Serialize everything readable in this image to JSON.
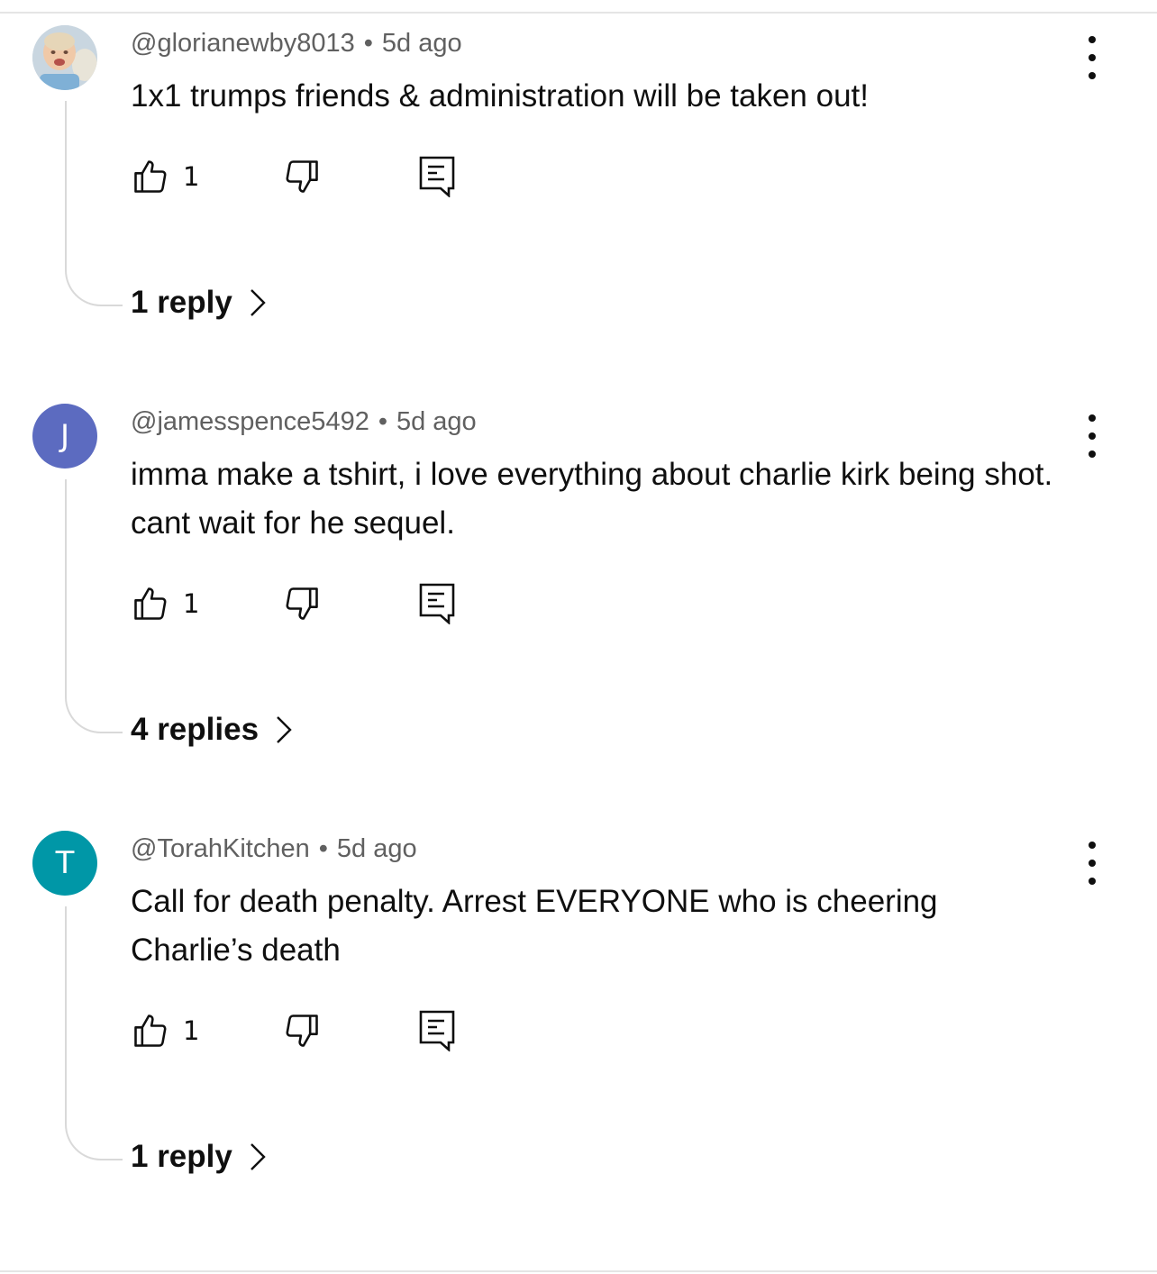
{
  "comments": [
    {
      "author": "@glorianewby8013",
      "separator": "•",
      "time": "5d ago",
      "text": "1x1 trumps friends & administration will be taken out!",
      "avatar_type": "photo",
      "likes": "1",
      "replies_label": "1 reply",
      "icons": [
        "like-icon",
        "dislike-icon",
        "reply-icon",
        "more-vert-icon",
        "chevron-right-icon"
      ]
    },
    {
      "author": "@jamesspence5492",
      "separator": "•",
      "time": "5d ago",
      "text": "imma make a tshirt, i love everything about charlie kirk being shot. cant wait for he sequel.",
      "avatar_letter": "J",
      "avatar_color": "#5c6bc0",
      "likes": "1",
      "replies_label": "4 replies"
    },
    {
      "author": "@TorahKitchen",
      "separator": "•",
      "time": "5d ago",
      "text": "Call for death penalty.  Arrest EVERYONE who is cheering Charlie’s death",
      "avatar_letter": "T",
      "avatar_color": "#0097a7",
      "likes": "1",
      "replies_label": "1 reply"
    }
  ],
  "colors": {
    "text_primary": "#0f0f0f",
    "text_secondary": "#606060",
    "divider": "#e5e5e5",
    "thread_line": "#d9d9d9"
  }
}
